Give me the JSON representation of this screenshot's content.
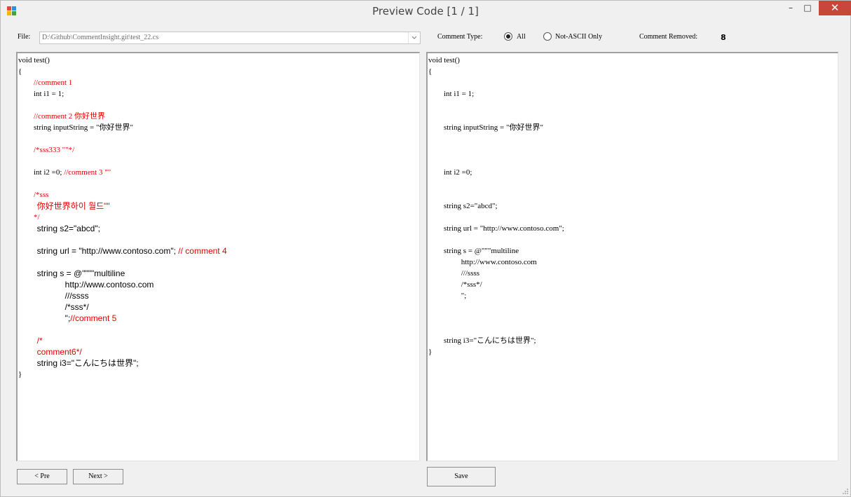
{
  "window": {
    "title": "Preview Code  [1 / 1]",
    "controls": {
      "minimize": "–",
      "maximize": "□",
      "close": "✕"
    }
  },
  "toolbar": {
    "file_label": "File:",
    "file_path": "D:\\Github\\CommentInsight.git\\test_22.cs",
    "comment_type_label": "Comment Type:",
    "options": [
      {
        "label": "All",
        "selected": true
      },
      {
        "label": "Not-ASCII Only",
        "selected": false
      }
    ],
    "comment_removed_label": "Comment Removed:",
    "comment_removed_value": "8"
  },
  "left_editor": {
    "lines": [
      {
        "segments": [
          {
            "t": "void test()"
          }
        ]
      },
      {
        "segments": [
          {
            "t": "{"
          }
        ]
      },
      {
        "segments": [
          {
            "t": "        //comment 1",
            "c": true
          }
        ]
      },
      {
        "segments": [
          {
            "t": "        int i1 = 1;"
          }
        ]
      },
      {
        "segments": []
      },
      {
        "segments": [
          {
            "t": "        //comment 2 你好世界",
            "c": true
          }
        ]
      },
      {
        "segments": [
          {
            "t": "        string inputString = \"你好世界\""
          }
        ]
      },
      {
        "segments": []
      },
      {
        "segments": [
          {
            "t": "        /*sss333 \"\"*/",
            "c": true
          }
        ]
      },
      {
        "segments": []
      },
      {
        "segments": [
          {
            "t": "        int i2 =0; "
          },
          {
            "t": "//comment 3 \"\"",
            "c": true
          }
        ]
      },
      {
        "segments": []
      },
      {
        "segments": [
          {
            "t": "        /*sss",
            "c": true
          }
        ]
      },
      {
        "segments": [
          {
            "t": "        你好世界하이 월드\"\"",
            "c": true,
            "s": true
          }
        ]
      },
      {
        "segments": [
          {
            "t": "        */",
            "c": true
          }
        ]
      },
      {
        "segments": [
          {
            "t": "        string s2=\"abcd\";",
            "s": true
          }
        ]
      },
      {
        "segments": []
      },
      {
        "segments": [
          {
            "t": "        string url = \"http://www.contoso.com\"; ",
            "s": true
          },
          {
            "t": "// comment 4",
            "c": true,
            "s": true
          }
        ]
      },
      {
        "segments": []
      },
      {
        "segments": [
          {
            "t": "        string s = @\"\"\"\"multiline",
            "s": true
          }
        ]
      },
      {
        "segments": [
          {
            "t": "                    http://www.contoso.com",
            "s": true
          }
        ]
      },
      {
        "segments": [
          {
            "t": "                    ///ssss",
            "s": true
          }
        ]
      },
      {
        "segments": [
          {
            "t": "                    /*sss*/",
            "s": true
          }
        ]
      },
      {
        "segments": [
          {
            "t": "                    \";",
            "s": true
          },
          {
            "t": "//comment 5",
            "c": true,
            "s": true
          }
        ]
      },
      {
        "segments": []
      },
      {
        "segments": [
          {
            "t": "        /*",
            "c": true,
            "s": true
          }
        ]
      },
      {
        "segments": [
          {
            "t": "        comment6*/",
            "c": true,
            "s": true
          }
        ]
      },
      {
        "segments": [
          {
            "t": "        string i3=\"こんにちは世界\";",
            "s": true
          }
        ]
      },
      {
        "segments": [
          {
            "t": "}"
          }
        ]
      }
    ]
  },
  "right_editor": {
    "lines": [
      {
        "segments": [
          {
            "t": "void test()"
          }
        ]
      },
      {
        "segments": [
          {
            "t": "{"
          }
        ]
      },
      {
        "segments": []
      },
      {
        "segments": [
          {
            "t": "        int i1 = 1;"
          }
        ]
      },
      {
        "segments": []
      },
      {
        "segments": []
      },
      {
        "segments": [
          {
            "t": "        string inputString = \"你好世界\""
          }
        ]
      },
      {
        "segments": []
      },
      {
        "segments": []
      },
      {
        "segments": []
      },
      {
        "segments": [
          {
            "t": "        int i2 =0;"
          }
        ]
      },
      {
        "segments": []
      },
      {
        "segments": []
      },
      {
        "segments": [
          {
            "t": "        string s2=\"abcd\";"
          }
        ]
      },
      {
        "segments": []
      },
      {
        "segments": [
          {
            "t": "        string url = \"http://www.contoso.com\";"
          }
        ]
      },
      {
        "segments": []
      },
      {
        "segments": [
          {
            "t": "        string s = @\"\"\"multiline"
          }
        ]
      },
      {
        "segments": [
          {
            "t": "                 http://www.contoso.com"
          }
        ]
      },
      {
        "segments": [
          {
            "t": "                 ///ssss"
          }
        ]
      },
      {
        "segments": [
          {
            "t": "                 /*sss*/"
          }
        ]
      },
      {
        "segments": [
          {
            "t": "                 \";"
          }
        ]
      },
      {
        "segments": []
      },
      {
        "segments": []
      },
      {
        "segments": []
      },
      {
        "segments": [
          {
            "t": "        string i3=\"こんにちは世界\";"
          }
        ]
      },
      {
        "segments": [
          {
            "t": "}"
          }
        ]
      }
    ]
  },
  "buttons": {
    "pre": "< Pre",
    "next": "Next >",
    "save": "Save"
  },
  "colors": {
    "comment": "#e00000",
    "close_button": "#c7473b"
  }
}
